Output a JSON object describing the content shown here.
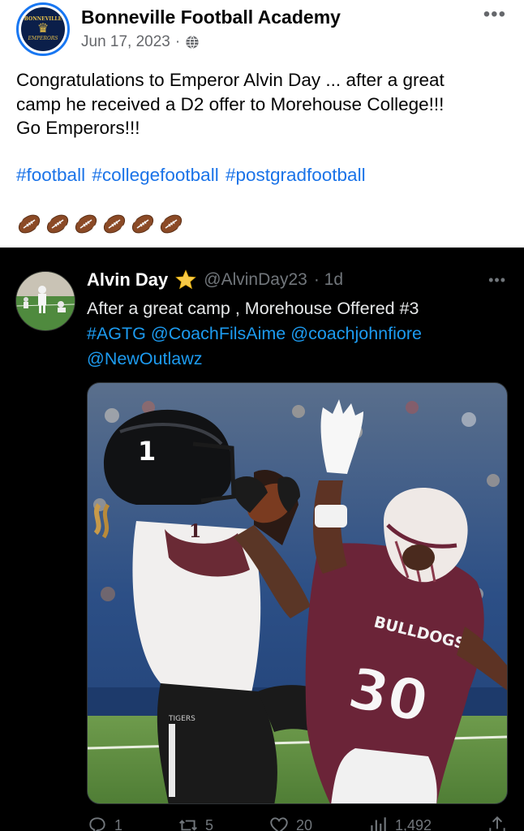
{
  "fb_post": {
    "page_name": "Bonneville Football Academy",
    "date": "Jun 17, 2023",
    "separator": "·",
    "more_label": "•••",
    "avatar_logo": {
      "top_text": "BONNEVILLE",
      "bottom_text": "EMPERORS"
    },
    "text_lines": [
      "Congratulations to Emperor Alvin Day ... after a great",
      "camp he received a D2 offer to Morehouse College!!!",
      "Go Emperors!!!"
    ],
    "hashtags": "#football #collegefootball #postgradfootball",
    "emoji_count": 6,
    "emoji_icon": "american-football-icon"
  },
  "tweet": {
    "name": "Alvin Day",
    "badge_icon": "star-icon",
    "handle": "@AlvinDay23",
    "time": "· 1d",
    "more_label": "•••",
    "line1": "After a great camp , Morehouse Offered #3",
    "line2_parts": [
      "#AGTG",
      "@CoachFilsAime",
      "@coachjohnfiore"
    ],
    "line3": "@NewOutlawz",
    "photo": {
      "receiver_helmet_number": "1",
      "receiver_jersey_number": "1",
      "receiver_pants_text": "TIGERS",
      "defender_jersey_text": "BULLDOGS",
      "defender_jersey_number": "30"
    },
    "actions": {
      "replies": "1",
      "retweets": "5",
      "likes": "20",
      "views": "1,492"
    }
  },
  "colors": {
    "fb_link": "#1a73e8",
    "fb_brand": "#1877f2",
    "tw_link": "#1d9bf0",
    "tw_background": "#000000",
    "maroon_jersey": "#6b2438"
  }
}
